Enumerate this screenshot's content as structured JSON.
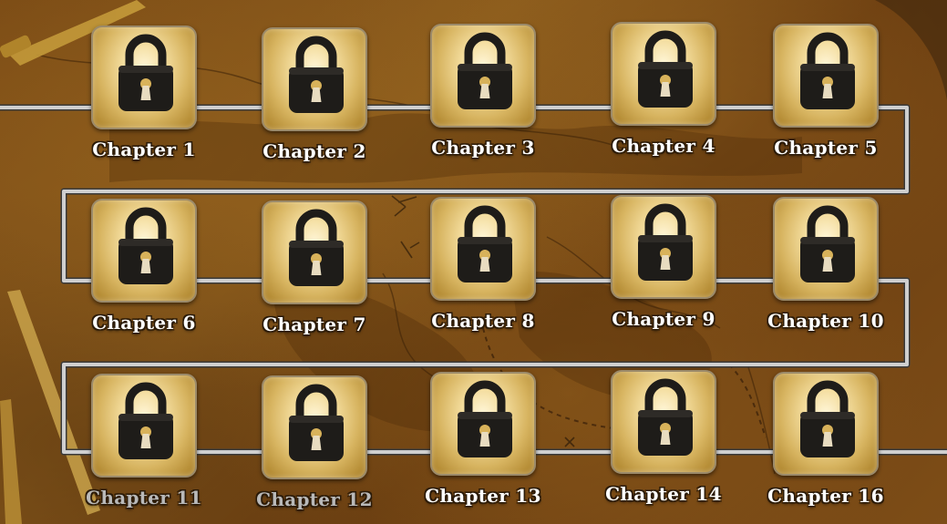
{
  "screen": {
    "type": "level-select",
    "lock_state": "locked",
    "lock_icon": "padlock-icon",
    "colors": {
      "tile_gold": "#e8c97a",
      "lock_body": "#1e1c19",
      "keyhole_gold": "#d8b25a",
      "path_silver": "#c8c8c8",
      "map_brown": "#7a4a15"
    }
  },
  "chapters": [
    {
      "label": "Chapter 1"
    },
    {
      "label": "Chapter 2"
    },
    {
      "label": "Chapter 3"
    },
    {
      "label": "Chapter 4"
    },
    {
      "label": "Chapter 5"
    },
    {
      "label": "Chapter 6"
    },
    {
      "label": "Chapter 7"
    },
    {
      "label": "Chapter 8"
    },
    {
      "label": "Chapter 9"
    },
    {
      "label": "Chapter 10"
    },
    {
      "label": "Chapter 11"
    },
    {
      "label": "Chapter 12"
    },
    {
      "label": "Chapter 13"
    },
    {
      "label": "Chapter 14"
    },
    {
      "label": "Chapter 16"
    }
  ]
}
